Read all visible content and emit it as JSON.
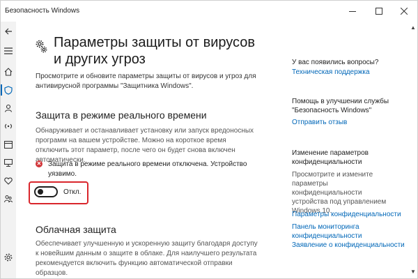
{
  "window": {
    "title": "Безопасность Windows"
  },
  "nav": {
    "icons": [
      "back-icon",
      "menu-icon",
      "home-icon",
      "shield-icon",
      "account-icon",
      "network-icon",
      "app-browser-icon",
      "device-security-icon",
      "health-icon",
      "family-icon",
      "settings-icon"
    ],
    "selected": "shield-icon"
  },
  "main": {
    "title": "Параметры защиты от вирусов и других угроз",
    "intro": "Просмотрите и обновите параметры защиты от вирусов и угроз для антивирусной программы \"Защитника Windows\".",
    "realtime": {
      "title": "Защита в режиме реального времени",
      "description": "Обнаруживает и останавливает установку или запуск вредоносных программ на вашем устройстве. Можно на короткое время отключить этот параметр, после чего он будет снова включен автоматически.",
      "alert": "Защита в режиме реального времени отключена. Устройство уязвимо.",
      "toggle_label": "Откл."
    },
    "cloud": {
      "title": "Облачная защита",
      "description": "Обеспечивает улучшенную и ускоренную защиту благодаря доступу к новейшим данным о защите в облаке. Для наилучшего результата рекомендуется включить функцию автоматической отправки образцов."
    }
  },
  "aside": {
    "questions_title": "У вас появились вопросы?",
    "support_link": "Техническая поддержка",
    "improve_title": "Помощь в улучшении службы \"Безопасность Windows\"",
    "feedback_link": "Отправить отзыв",
    "privacy_title": "Изменение параметров конфиденциальности",
    "privacy_text": "Просмотрите и измените параметры конфиденциальности устройства под управлением Windows 10.",
    "privacy_settings_link": "Параметры конфиденциальности",
    "privacy_dashboard_link": "Панель мониторинга конфиденциальности",
    "privacy_statement_link": "Заявление о конфиденциальности"
  },
  "colors": {
    "accent": "#0067b8",
    "alert_red": "#d13438",
    "highlight_red": "#d9262c"
  }
}
